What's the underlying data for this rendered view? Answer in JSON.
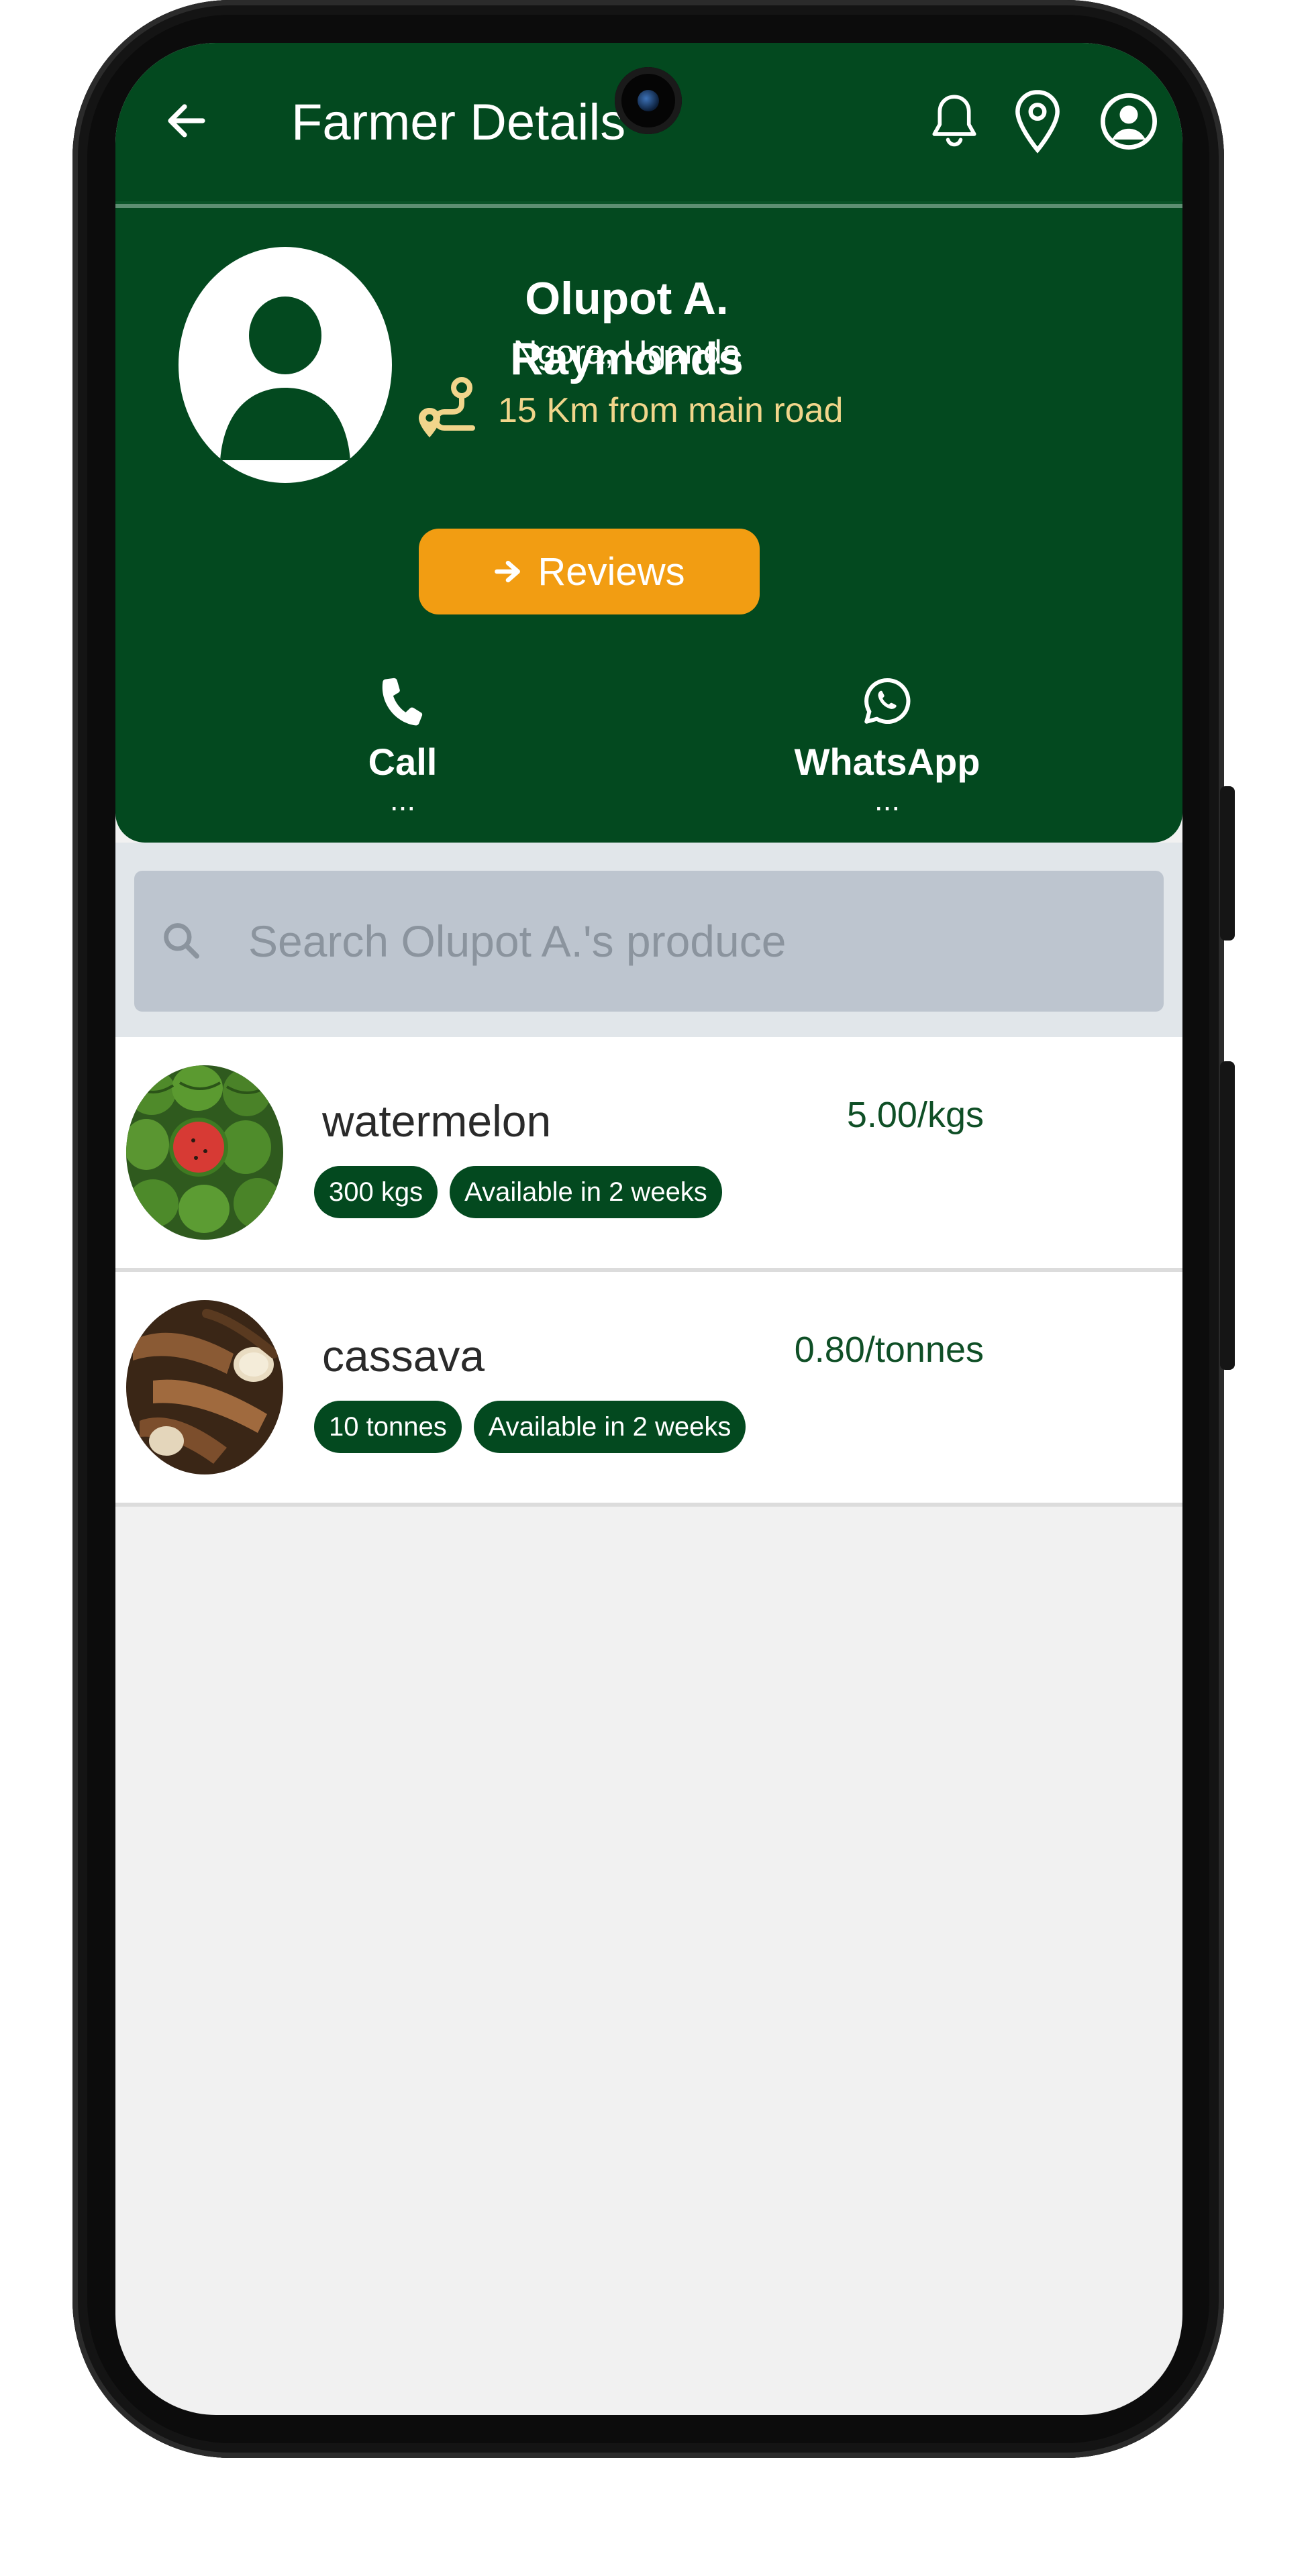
{
  "appbar": {
    "title": "Farmer Details",
    "icons": [
      "back-arrow-icon",
      "bell-icon",
      "location-pin-icon",
      "account-icon"
    ]
  },
  "farmer": {
    "name": "Olupot A. Raymonds",
    "location": "Ngora, Uganda",
    "distance": "15 Km from main road",
    "reviews_label": "Reviews"
  },
  "contacts": {
    "call": {
      "label": "Call",
      "value": "..."
    },
    "whatsapp": {
      "label": "WhatsApp",
      "value": "..."
    }
  },
  "search": {
    "placeholder": "Search Olupot A.'s produce"
  },
  "produce": [
    {
      "name": "watermelon",
      "price": "5.00/kgs",
      "quantity": "300 kgs",
      "availability": "Available in 2 weeks"
    },
    {
      "name": "cassava",
      "price": "0.80/tonnes",
      "quantity": "10 tonnes",
      "availability": "Available in 2 weeks"
    }
  ],
  "colors": {
    "primary_green": "#03491f",
    "accent_orange": "#f29d12",
    "distance_text": "#f1d58b",
    "search_bg": "#bdc5cf"
  }
}
